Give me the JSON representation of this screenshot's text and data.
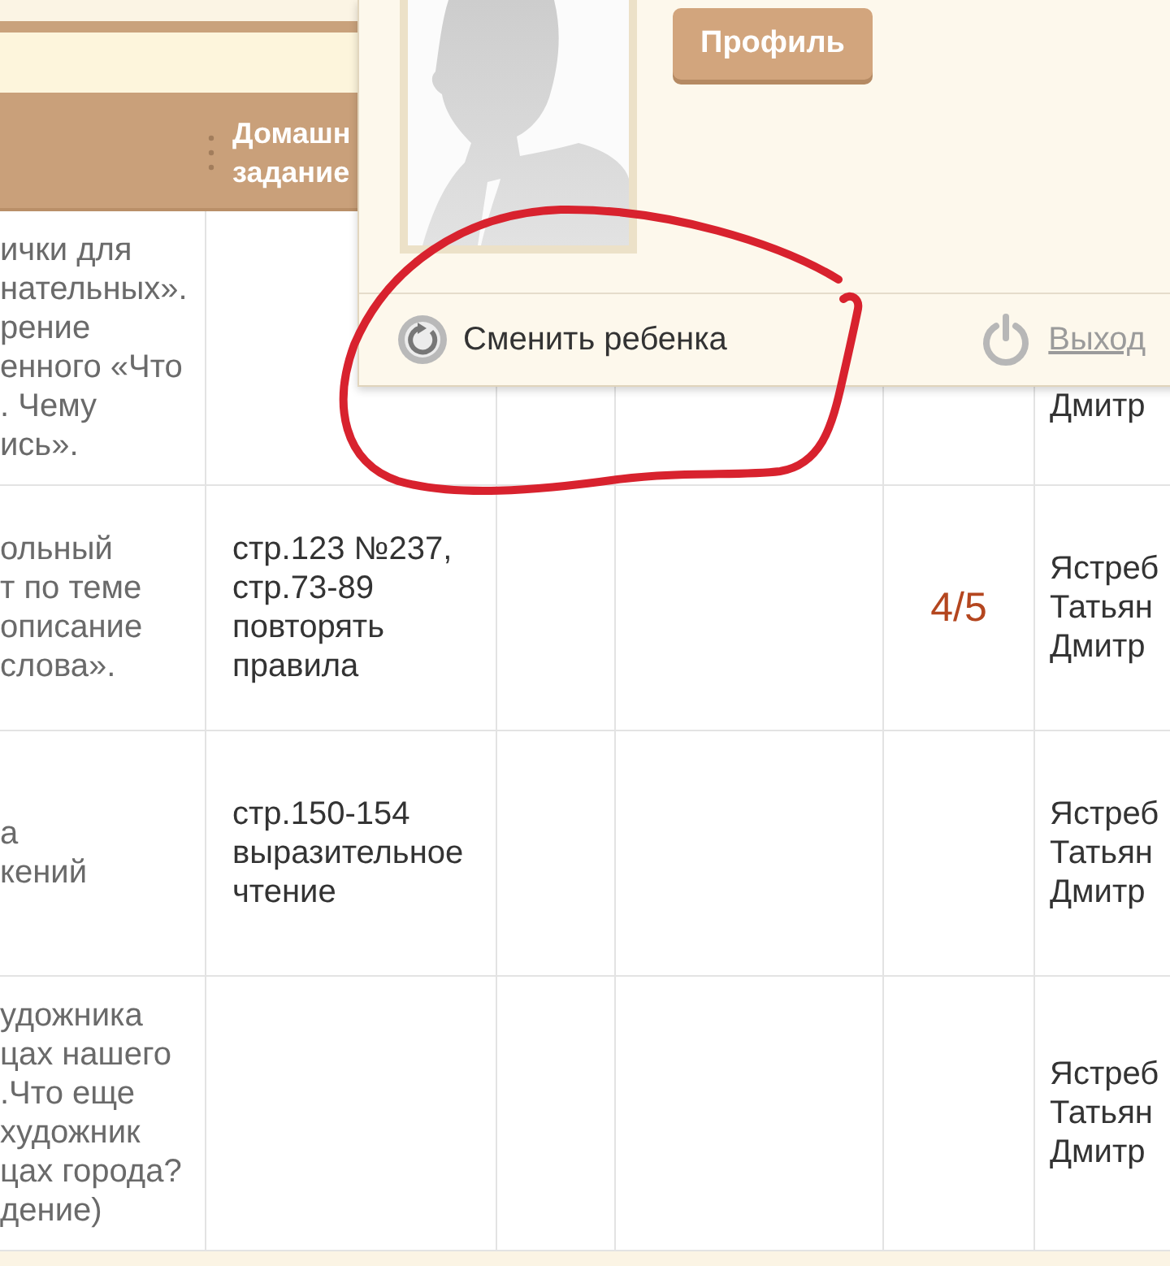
{
  "table": {
    "homework_heading": [
      "Домашн",
      "задание"
    ],
    "rows": [
      {
        "column_1": [
          "ички для",
          "нательных».",
          "рение",
          "енного «Что",
          ". Чему",
          "ись»."
        ],
        "column_6": [
          "Дмитр"
        ]
      },
      {
        "column_1": [
          "ольный",
          "т по теме",
          "описание",
          "слова»."
        ],
        "homework": [
          "стр.123 №237,",
          "стр.73-89",
          "повторять",
          "правила"
        ],
        "column_5": "4/5",
        "column_6": [
          "Ястреб",
          "Татьян",
          "Дмитр"
        ]
      },
      {
        "column_1": [
          "а",
          "кений"
        ],
        "homework": [
          "стр.150-154",
          "выразительное",
          "чтение"
        ],
        "column_6": [
          "Ястреб",
          "Татьян",
          "Дмитр"
        ]
      },
      {
        "column_1": [
          "удожника",
          "цах нашего",
          ".Что еще",
          "художник",
          "цах города?",
          "дение)"
        ],
        "column_6": [
          "Ястреб",
          "Татьян",
          "Дмитр"
        ]
      }
    ]
  },
  "popup": {
    "profile_button": "Профиль",
    "switch_child": "Сменить ребенка",
    "logout": "Выход"
  }
}
